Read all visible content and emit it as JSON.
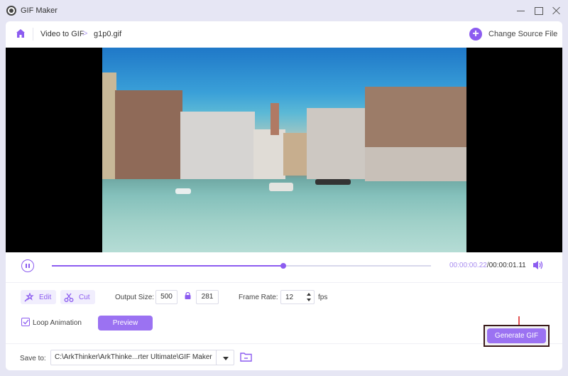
{
  "window": {
    "title": "GIF Maker",
    "controls": [
      "minimize",
      "maximize",
      "close"
    ]
  },
  "breadcrumb": {
    "home_icon": "home-icon",
    "items": [
      "Video to GIF",
      "g1p0.gif"
    ],
    "separator": ">"
  },
  "header": {
    "change_source_label": "Change Source File",
    "change_source_icon": "plus-circle-icon"
  },
  "player": {
    "content": "Video frame: Grand Canal in Venice with boats, buildings and Rialto Bridge",
    "state": "playing",
    "progress_fraction": 0.61,
    "current_time": "00:00:00.22",
    "time_separator": "/",
    "total_time": "00:00:01.11",
    "volume_icon": "speaker-icon"
  },
  "settings": {
    "edit_label": "Edit",
    "cut_label": "Cut",
    "output_size_label": "Output Size:",
    "width": "500",
    "height": "281",
    "aspect_locked": true,
    "frame_rate_label": "Frame Rate:",
    "frame_rate": "12",
    "fps_label": "fps",
    "loop_label": "Loop Animation",
    "loop_checked": true,
    "preview_label": "Preview"
  },
  "footer": {
    "save_to_label": "Save to:",
    "save_path": "C:\\ArkThinker\\ArkThinke...rter Ultimate\\GIF Maker",
    "generate_label": "Generate GIF"
  },
  "colors": {
    "accent": "#8c5cf0",
    "button": "#9b72f2",
    "annotation_arrow": "#d81b1b",
    "annotation_box": "#3a1a1a"
  }
}
